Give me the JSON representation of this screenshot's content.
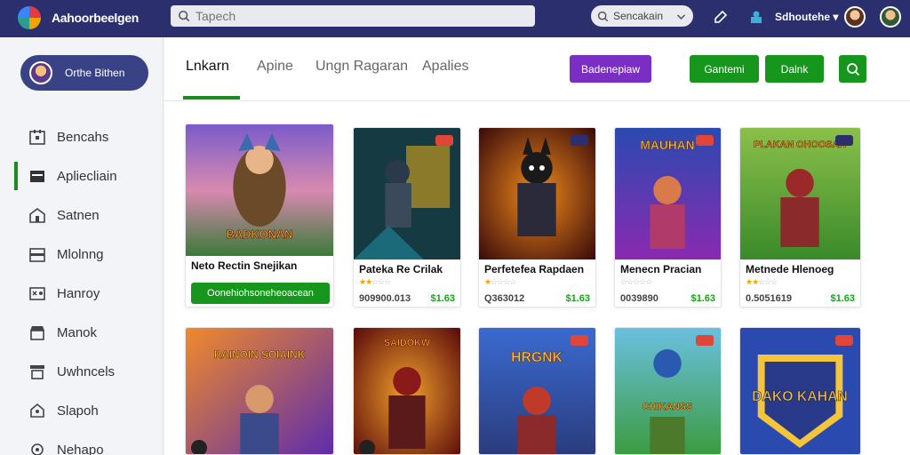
{
  "app": {
    "title": "Aahoorbeelgen"
  },
  "search": {
    "placeholder": "Tapech"
  },
  "filter": {
    "selected": "Sencakain"
  },
  "user": {
    "name": "Sdhoutehe"
  },
  "sidebar": {
    "profile_label": "Orthe Bithen",
    "items": [
      {
        "label": "Bencahs",
        "icon": "calendar-icon"
      },
      {
        "label": "Apliecliain",
        "icon": "folder-icon"
      },
      {
        "label": "Satnen",
        "icon": "home-icon"
      },
      {
        "label": "Mlolnng",
        "icon": "inbox-icon"
      },
      {
        "label": "Hanroy",
        "icon": "gamepad-icon"
      },
      {
        "label": "Manok",
        "icon": "store-icon"
      },
      {
        "label": "Uwhncels",
        "icon": "list-icon"
      },
      {
        "label": "Slapoh",
        "icon": "house-icon"
      },
      {
        "label": "Nehapo",
        "icon": "gear-icon"
      }
    ]
  },
  "tabs": [
    {
      "label": "Lnkarn",
      "active": true
    },
    {
      "label": "Apine",
      "active": false
    },
    {
      "label": "Ungn Ragaran",
      "active": false
    },
    {
      "label": "Apalies",
      "active": false
    }
  ],
  "actions": {
    "purple_label": "Badenepiaw",
    "green1_label": "Gantemi",
    "green2_label": "Dalnk"
  },
  "colors": {
    "accent": "#17961d",
    "topbar": "#2b2f6e",
    "purple": "#7b2ec4"
  },
  "cards": [
    {
      "title": "Neto Rectin Snejikan",
      "art_text": "BADKONAN",
      "install_label": "Oonehiohsoneheoacean"
    },
    {
      "title": "Pateka Re Crilak",
      "stars": 2,
      "price_old": "909900.013",
      "price_new": "$1.63"
    },
    {
      "title": "Perfetefea Rapdaen",
      "stars": 1,
      "price_old": "Q363012",
      "price_new": "$1.63"
    },
    {
      "title": "Menecn Pracian",
      "art_text": "MAUHAN",
      "stars": 0,
      "price_old": "0039890",
      "price_new": "$1.63"
    },
    {
      "title": "Metnede Hlenoeg",
      "art_text": "PLAKAN OHOOSAN",
      "stars": 2,
      "price_old": "0.5051619",
      "price_new": "$1.63"
    },
    {
      "art_text": "RAINOIN SOIAINK"
    },
    {
      "art_text": "SAIDOKW"
    },
    {
      "art_text": "HRGNK"
    },
    {
      "art_text": "CHIKANSS"
    },
    {
      "art_text": "DAKO KAHAN"
    }
  ]
}
